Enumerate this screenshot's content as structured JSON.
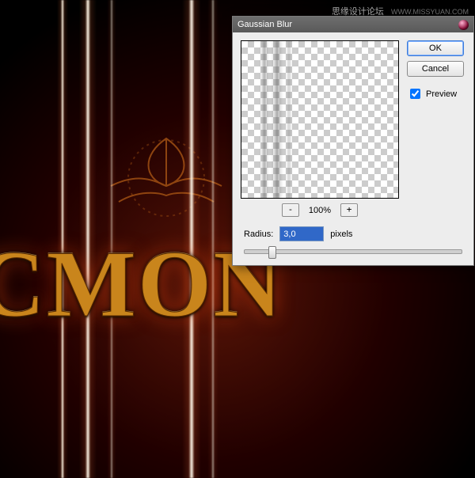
{
  "watermark": {
    "main": "思缘设计论坛",
    "sub": "WWW.MISSYUAN.COM"
  },
  "artwork_text": "CMON",
  "dialog": {
    "title": "Gaussian Blur",
    "buttons": {
      "ok": "OK",
      "cancel": "Cancel"
    },
    "preview_checkbox": {
      "label": "Preview",
      "checked": true
    },
    "zoom": {
      "minus": "-",
      "plus": "+",
      "level": "100%"
    },
    "radius": {
      "label": "Radius:",
      "value": "3,0",
      "unit": "pixels"
    },
    "slider": {
      "min": 0.1,
      "max": 250,
      "value": 3.0,
      "position_percent": 11
    }
  }
}
